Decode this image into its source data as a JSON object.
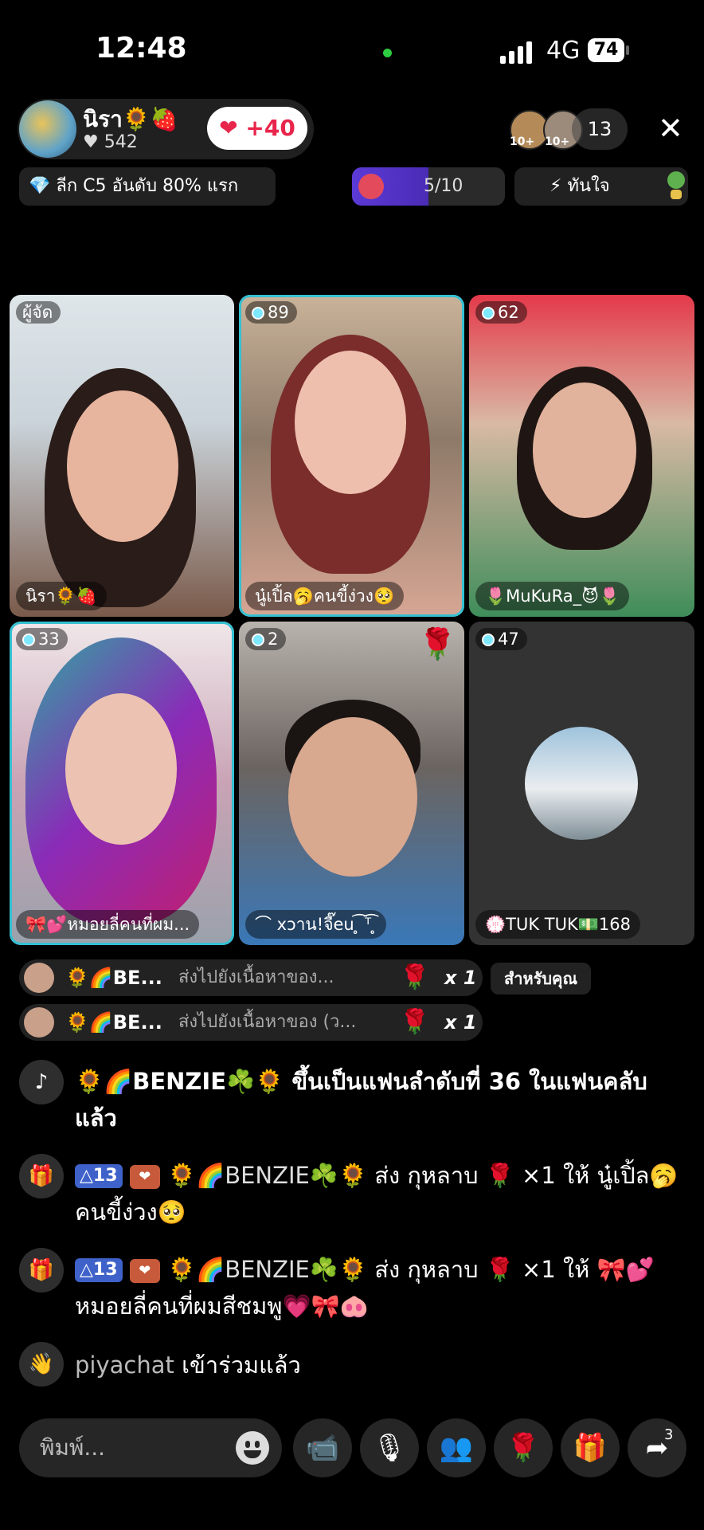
{
  "status_bar": {
    "time": "12:48",
    "network": "4G",
    "battery": "74"
  },
  "host": {
    "name": "นิรา🌻🍓",
    "likes": "♥ 542",
    "plus": "❤ +40"
  },
  "viewers": {
    "badge1": "10+",
    "badge2": "10+",
    "count": "13"
  },
  "close_icon": "✕",
  "league": {
    "text": "💎 ลีก C5 อันดับ 80% แรก"
  },
  "progress": {
    "text": "5/10",
    "value": 0.5
  },
  "quick": {
    "text": "⚡ ทันใจ"
  },
  "tiles": [
    {
      "badge": "ผู้จัด",
      "name": "นิรา🌻🍓"
    },
    {
      "badge": "89",
      "name": "นู๋เปิ้ล🥱คนขี้ง่วง🥺"
    },
    {
      "badge": "62",
      "name": "🌷MuKuRa_😈🌷"
    },
    {
      "badge": "33",
      "name": "🎀💕หมอยลี่คนที่ผม..."
    },
    {
      "badge": "2",
      "name": "⌒ xɔาน!จี๊eu ̥͡ ᵀ͡ ̥",
      "corner": "🌹"
    },
    {
      "badge": "47",
      "name": "💮TUK TUK💵168"
    }
  ],
  "gifts": [
    {
      "sender": "🌻🌈BE...",
      "message": "ส่งไปยังเนื้อหาของ...",
      "rose": "🌹",
      "count": "x 1"
    },
    {
      "sender": "🌻🌈BE...",
      "message": "ส่งไปยังเนื้อหาของ (ว...",
      "rose": "🌹",
      "count": "x 1"
    }
  ],
  "for_you": "สำหรับคุณ",
  "comments": [
    {
      "icon": "♪",
      "text": "🌻🌈BENZIE☘️🌻 ขึ้นเป็นแฟนลำดับที่ 36 ในแฟนคลับแล้ว"
    },
    {
      "icon": "🎁",
      "level": "△13",
      "badge": "❤",
      "sender": "🌻🌈BENZIE☘️🌻",
      "text": "ส่ง กุหลาบ 🌹 ×1 ให้ นู๋เปิ้ล🥱คนขี้ง่วง🥺"
    },
    {
      "icon": "🎁",
      "level": "△13",
      "badge": "❤",
      "sender": "🌻🌈BENZIE☘️🌻",
      "text": "ส่ง กุหลาบ 🌹 ×1 ให้ 🎀💕 หมอยลี่คนที่ผมสีชมพู💗🎀🐽"
    },
    {
      "icon": "👋",
      "sender": "piyachat",
      "text": "เข้าร่วมแล้ว"
    }
  ],
  "input": {
    "placeholder": "พิมพ์..."
  },
  "actions": {
    "video": "📹",
    "mic": "🎙",
    "guests": "👥",
    "rose": "🌹",
    "gift": "🎁",
    "share": "➦",
    "share_count": "3"
  }
}
